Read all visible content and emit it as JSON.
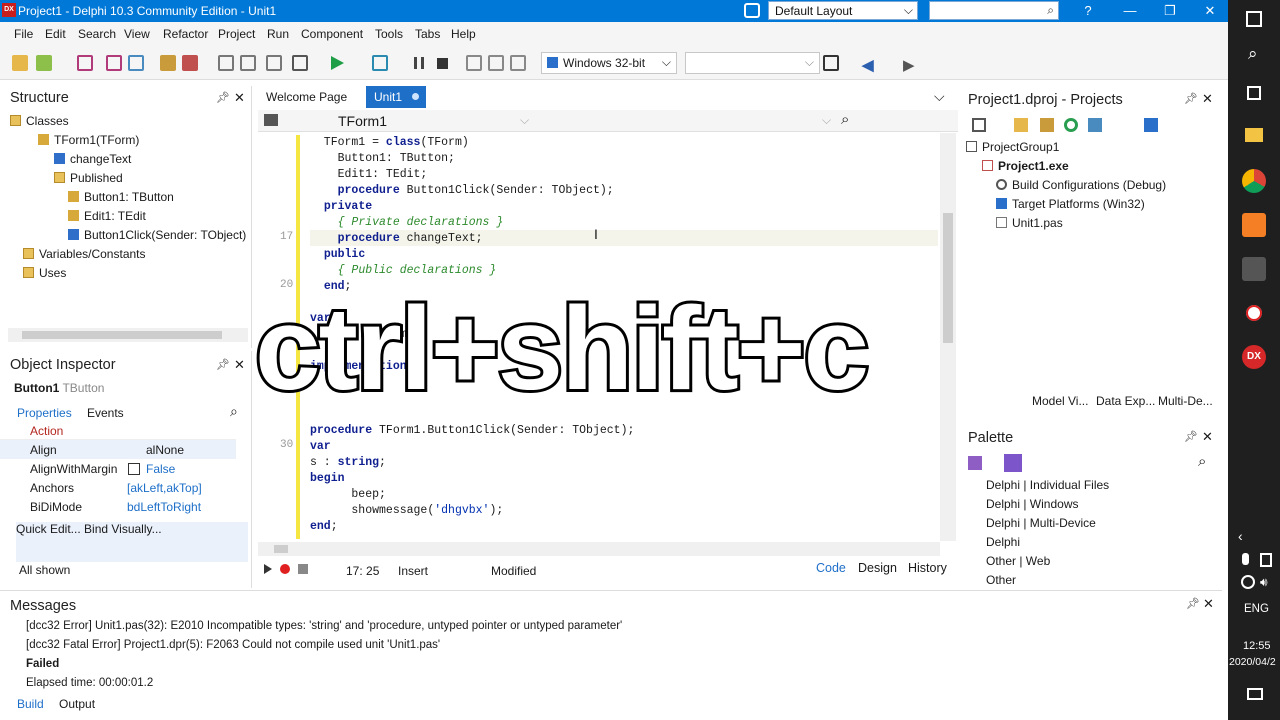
{
  "window": {
    "title": "Project1 - Delphi 10.3 Community Edition - Unit1",
    "app_badge": "DX",
    "layout": "Default Layout"
  },
  "menu": [
    "File",
    "Edit",
    "Search",
    "View",
    "Refactor",
    "Project",
    "Run",
    "Component",
    "Tools",
    "Tabs",
    "Help"
  ],
  "toolbar": {
    "platform": "Windows 32-bit"
  },
  "structure": {
    "title": "Structure",
    "items": [
      "Classes",
      "TForm1(TForm)",
      "changeText",
      "Published",
      "Button1: TButton",
      "Edit1: TEdit",
      "Button1Click(Sender: TObject)",
      "Variables/Constants",
      "Uses"
    ]
  },
  "inspector": {
    "title": "Object Inspector",
    "object": "Button1",
    "object_type": "TButton",
    "tabs": [
      "Properties",
      "Events"
    ],
    "props": [
      {
        "name": "Action",
        "value": ""
      },
      {
        "name": "Align",
        "value": "alNone"
      },
      {
        "name": "AlignWithMargin",
        "value": "False"
      },
      {
        "name": "Anchors",
        "value": "[akLeft,akTop]"
      },
      {
        "name": "BiDiMode",
        "value": "bdLeftToRight"
      }
    ],
    "links": "Quick Edit...  Bind Visually...",
    "status": "All shown"
  },
  "editor": {
    "tabs": [
      "Welcome Page",
      "Unit1"
    ],
    "class_combo": "TForm1",
    "position": "17: 25",
    "mode": "Insert",
    "state": "Modified",
    "views": [
      "Code",
      "Design",
      "History"
    ],
    "line_numbers": {
      "17": "17",
      "20": "20",
      "30": "30"
    }
  },
  "projects": {
    "title": "Project1.dproj - Projects",
    "items": [
      "ProjectGroup1",
      "Project1.exe",
      "Build Configurations (Debug)",
      "Target Platforms (Win32)",
      "Unit1.pas"
    ],
    "tabs": [
      "Model Vi...",
      "Data Exp...",
      "Multi-De..."
    ]
  },
  "palette": {
    "title": "Palette",
    "items": [
      "Delphi | Individual Files",
      "Delphi | Windows",
      "Delphi | Multi-Device",
      "Delphi",
      "Other | Web",
      "Other"
    ]
  },
  "messages": {
    "title": "Messages",
    "lines": [
      "[dcc32 Error] Unit1.pas(32): E2010 Incompatible types: 'string' and 'procedure, untyped pointer or untyped parameter'",
      "[dcc32 Fatal Error] Project1.dpr(5): F2063 Could not compile used unit 'Unit1.pas'",
      "Failed",
      "Elapsed time: 00:00:01.2"
    ],
    "tabs": [
      "Build",
      "Output"
    ]
  },
  "overlay": "ctrl+shift+c",
  "taskbar": {
    "lang": "ENG",
    "time": "12:55",
    "date": "2020/04/2"
  },
  "colors": {
    "titlebar": "#0078d7",
    "accent": "#1e6fc8"
  }
}
